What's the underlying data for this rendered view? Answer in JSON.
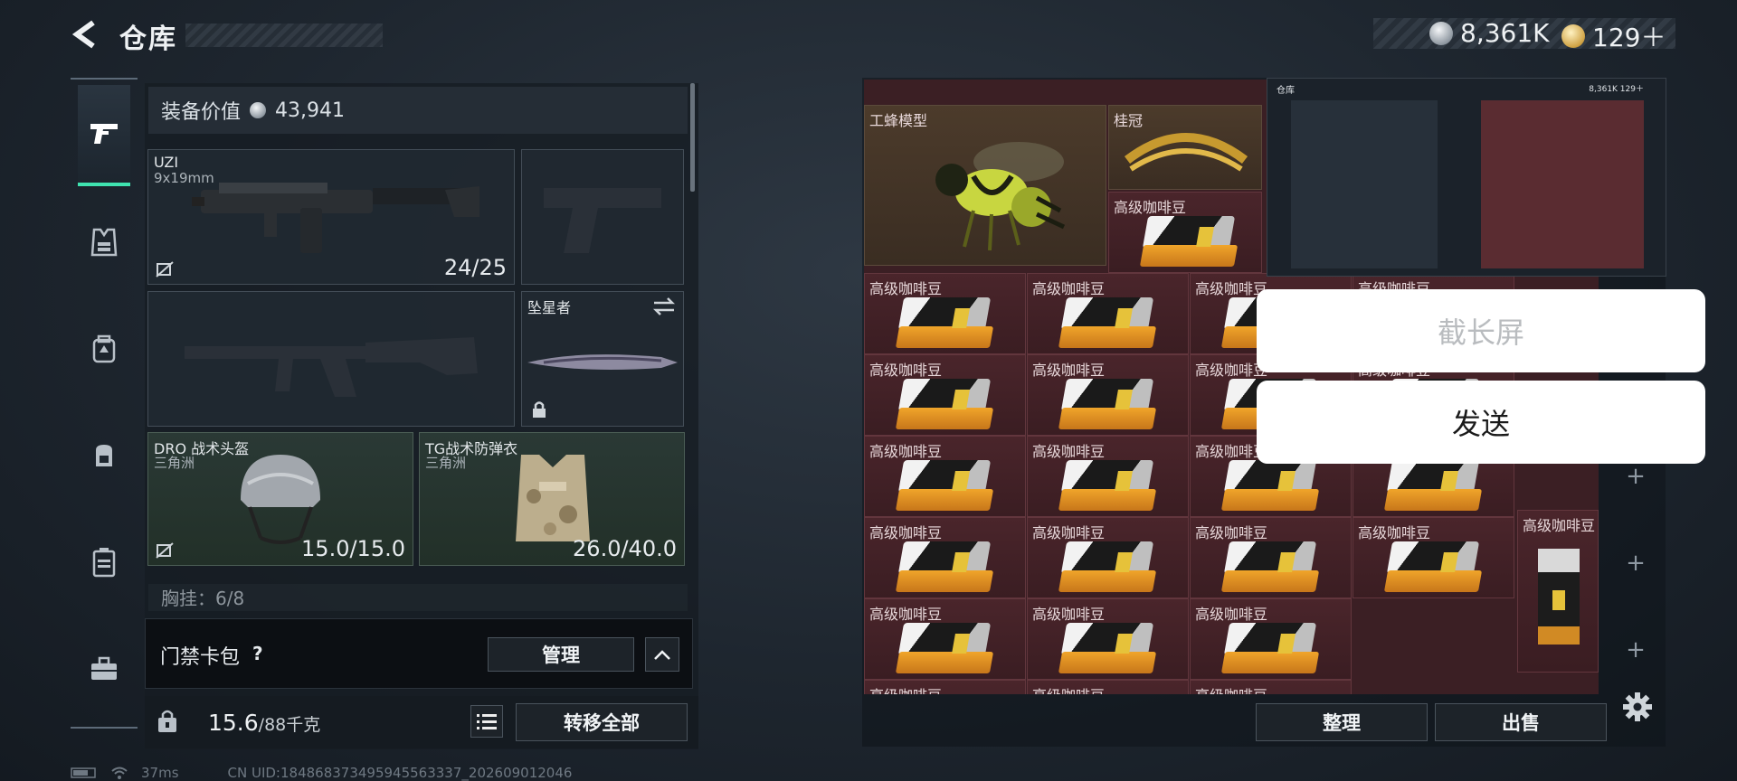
{
  "header": {
    "title": "仓库"
  },
  "currency": [
    {
      "icon": "silver-coin-icon",
      "value": "8,361K"
    },
    {
      "icon": "gold-coin-icon",
      "value": "129＋"
    }
  ],
  "sidebar": {
    "items": [
      {
        "icon": "pistol-icon",
        "active": true
      },
      {
        "icon": "vest-icon"
      },
      {
        "icon": "chest-rig-icon"
      },
      {
        "icon": "backpack-icon"
      },
      {
        "icon": "case-icon"
      },
      {
        "icon": "toolbox-icon"
      }
    ]
  },
  "equipment": {
    "value_label": "装备价值",
    "value": "43,941",
    "slots": {
      "primary": {
        "name": "UZI",
        "sub": "9x19mm",
        "value": "24/25"
      },
      "melee": {
        "name": "坠星者"
      },
      "helmet": {
        "name": "DRO 战术头盔",
        "sub": "三角洲",
        "value": "15.0/15.0"
      },
      "armor": {
        "name": "TG战术防弹衣",
        "sub": "三角洲",
        "value": "26.0/40.0"
      }
    },
    "peek_text": "胸挂：6/8"
  },
  "keycard": {
    "label": "门禁卡包",
    "help": "?",
    "manage_label": "管理"
  },
  "bottom": {
    "weight": "15.6",
    "weight_max": "/88千克",
    "transfer_label": "转移全部"
  },
  "storage": {
    "top_items": [
      {
        "name": "工蜂模型"
      },
      {
        "name": "桂冠"
      },
      {
        "name": "高级咖啡豆"
      }
    ],
    "item_name": "高级咖啡豆",
    "organize_label": "整理",
    "sell_label": "出售"
  },
  "thumbnail": {
    "title": "仓库",
    "currency": "8,361K  129＋"
  },
  "overlay": {
    "long_screenshot": "截长屏",
    "send": "发送"
  },
  "status": {
    "ping": "37ms",
    "uid": "CN UID:184868373495945563337_202609012046"
  }
}
